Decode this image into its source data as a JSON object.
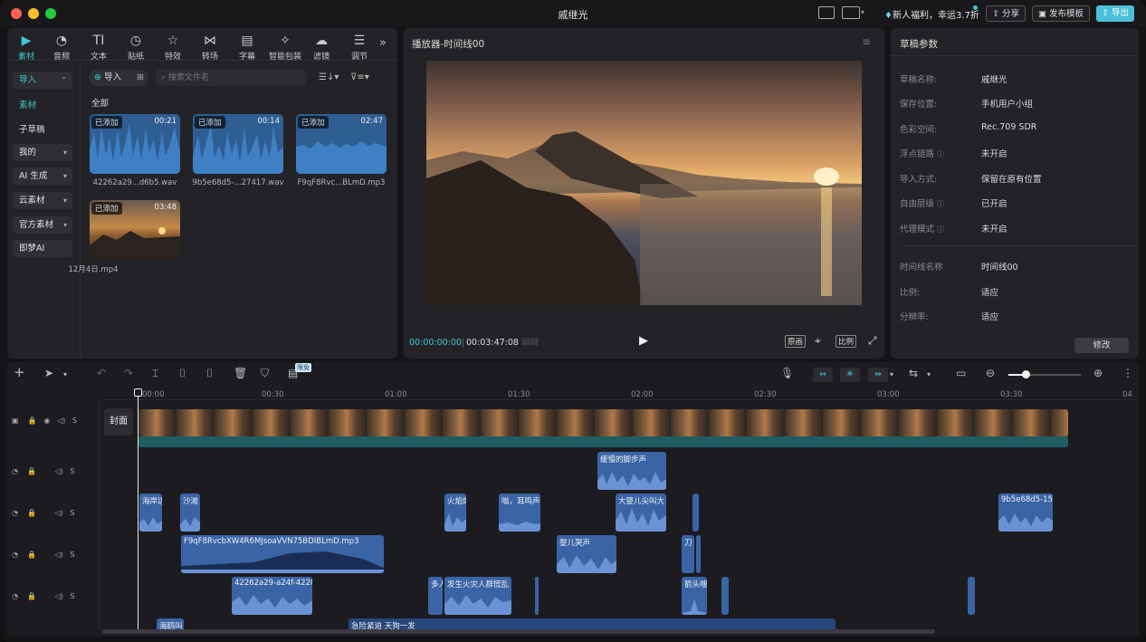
{
  "window": {
    "title": "戚继光",
    "promo": "新人福利，幸运3.7折",
    "share": "分享",
    "publish": "发布模板",
    "export": "导出"
  },
  "toolbar": [
    {
      "label": "素材",
      "icon": "media-icon"
    },
    {
      "label": "音频",
      "icon": "audio-icon"
    },
    {
      "label": "文本",
      "icon": "text-icon"
    },
    {
      "label": "贴纸",
      "icon": "sticker-icon"
    },
    {
      "label": "特效",
      "icon": "effects-icon"
    },
    {
      "label": "转场",
      "icon": "transition-icon"
    },
    {
      "label": "字幕",
      "icon": "subtitle-icon"
    },
    {
      "label": "智能包装",
      "icon": "smart-pack-icon"
    },
    {
      "label": "滤镜",
      "icon": "filter-icon"
    },
    {
      "label": "调节",
      "icon": "adjust-icon"
    }
  ],
  "sidebar": {
    "import": "导入",
    "items": [
      "素材",
      "子草稿",
      "我的",
      "AI 生成",
      "云素材",
      "官方素材",
      "即梦AI"
    ]
  },
  "media": {
    "import_button": "导入",
    "search_placeholder": "搜索文件名",
    "section": "全部",
    "items": [
      {
        "tag": "已添加",
        "duration": "00:21",
        "name": "42262a29...d6b5.wav",
        "kind": "audio"
      },
      {
        "tag": "已添加",
        "duration": "00:14",
        "name": "9b5e68d5-...27417.wav",
        "kind": "audio"
      },
      {
        "tag": "已添加",
        "duration": "02:47",
        "name": "F9qF8Rvc...BLmD.mp3",
        "kind": "audio"
      },
      {
        "tag": "已添加",
        "duration": "03:48",
        "name": "12月4日.mp4",
        "kind": "video"
      }
    ]
  },
  "player": {
    "title": "播放器-时间线00",
    "current": "00:00:00:00",
    "total": "00:03:47:08",
    "btn_original": "原画",
    "btn_ratio": "比例"
  },
  "props": {
    "title": "草稿参数",
    "rows": [
      {
        "k": "草稿名称:",
        "v": "戚继光"
      },
      {
        "k": "保存位置:",
        "v": "手机用户小组"
      },
      {
        "k": "色彩空间:",
        "v": "Rec.709 SDR"
      },
      {
        "k": "浮点链路",
        "v": "未开启",
        "help": true
      },
      {
        "k": "导入方式:",
        "v": "保留在原有位置"
      },
      {
        "k": "自由层级",
        "v": "已开启",
        "help": true
      },
      {
        "k": "代理模式",
        "v": "未开启",
        "help": true
      }
    ],
    "rows2": [
      {
        "k": "时间线名称",
        "v": "时间线00"
      },
      {
        "k": "比例:",
        "v": "适应"
      },
      {
        "k": "分辨率:",
        "v": "适应"
      }
    ],
    "modify": "修改"
  },
  "timeline": {
    "badge": "限免",
    "ruler": [
      "00:00",
      "00:30",
      "01:00",
      "01:30",
      "02:00",
      "02:30",
      "03:00",
      "03:30",
      "04"
    ],
    "cover": "封面",
    "clips": [
      {
        "label": "缓慢的脚步声",
        "track": 1
      },
      {
        "label": "海岸边",
        "track": 2
      },
      {
        "label": "沙滩",
        "track": 2
      },
      {
        "label": "火焰燃",
        "track": 2
      },
      {
        "label": "嗡，耳鸣声",
        "track": 2
      },
      {
        "label": "大婴儿尖叫大",
        "track": 2
      },
      {
        "label": "9b5e68d5-158",
        "track": 2
      },
      {
        "label": "F9qF8RvcbXW4R6MJsoaVVN75BDIBLmD.mp3",
        "track": 3
      },
      {
        "label": "婴儿哭声",
        "track": 3
      },
      {
        "label": "刀",
        "track": 3
      },
      {
        "label": "42262a29-a24f-4228",
        "track": 4
      },
      {
        "label": "多人",
        "track": 4
      },
      {
        "label": "发生火灾人群慌乱",
        "track": 4
      },
      {
        "label": "箭头嗖",
        "track": 4
      },
      {
        "label": "海鸥叫",
        "track": 5
      },
      {
        "label": "急险紧迫 天狗一发",
        "track": 5
      }
    ]
  },
  "colors": {
    "accent": "#3ec9d6",
    "clip": "#3a64a6",
    "export_bg": "#4bbfd9"
  }
}
